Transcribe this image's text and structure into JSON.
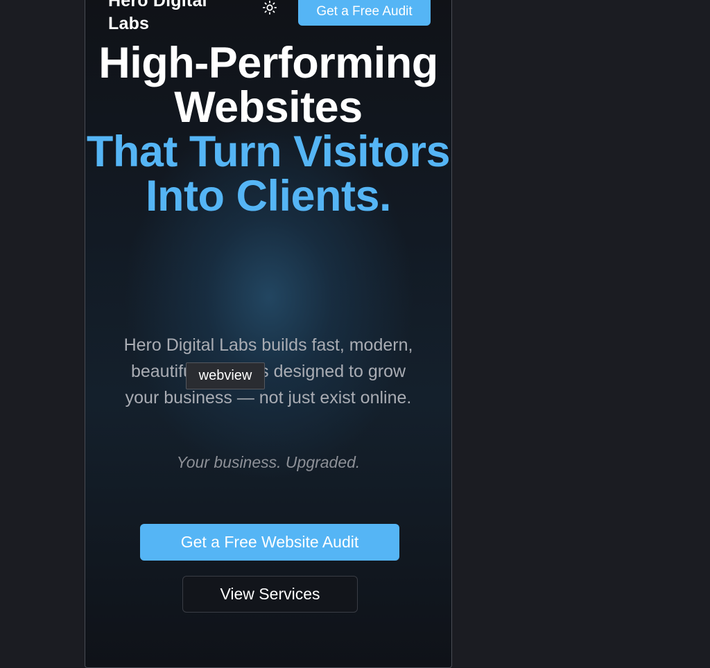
{
  "header": {
    "brand_name": "Hero Digital Labs",
    "theme_toggle_icon": "sun-icon",
    "cta_label": "Get a Free Audit"
  },
  "hero": {
    "title_line_white": "High-Performing Websites",
    "title_line_blue": "That Turn Visitors Into Clients.",
    "subtitle": "Hero Digital Labs builds fast, modern, beautiful websites designed to grow your business — not just exist online.",
    "tagline": "Your business. Upgraded.",
    "primary_button": "Get a Free Website Audit",
    "secondary_button": "View Services"
  },
  "tooltip": {
    "text": "webview"
  },
  "colors": {
    "accent": "#55b5f5",
    "background": "#1b1c22"
  }
}
